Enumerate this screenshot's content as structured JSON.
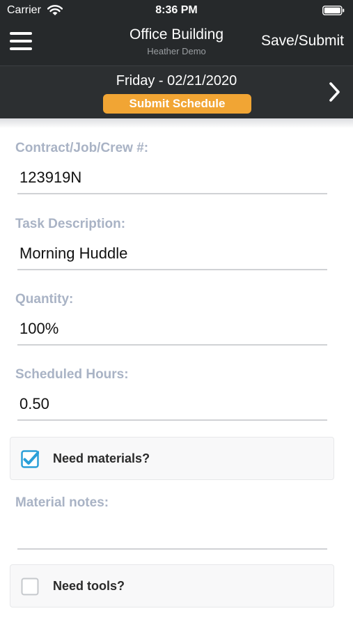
{
  "status_bar": {
    "carrier": "Carrier",
    "time": "8:36 PM",
    "wifi_icon": "wifi-icon",
    "battery_icon": "battery-icon"
  },
  "nav": {
    "title": "Office Building",
    "subtitle": "Heather Demo",
    "save_label": "Save/Submit",
    "menu_icon": "hamburger-menu-icon"
  },
  "date_bar": {
    "date": "Friday - 02/21/2020",
    "submit_label": "Submit Schedule",
    "next_icon": "chevron-right-icon",
    "submit_color": "#f1a534"
  },
  "form": {
    "contract": {
      "label": "Contract/Job/Crew #:",
      "value": "123919N"
    },
    "task": {
      "label": "Task Description:",
      "value": "Morning Huddle"
    },
    "quantity": {
      "label": "Quantity:",
      "value": "100%"
    },
    "hours": {
      "label": "Scheduled Hours:",
      "value": "0.50"
    },
    "need_materials": {
      "label": "Need materials?",
      "checked": true
    },
    "material_notes": {
      "label": "Material notes:",
      "value": ""
    },
    "need_tools": {
      "label": "Need tools?",
      "checked": false
    }
  },
  "colors": {
    "header_bg": "#26292b",
    "label": "#a9b3c5",
    "checkbox_accent": "#2a9fd8"
  }
}
